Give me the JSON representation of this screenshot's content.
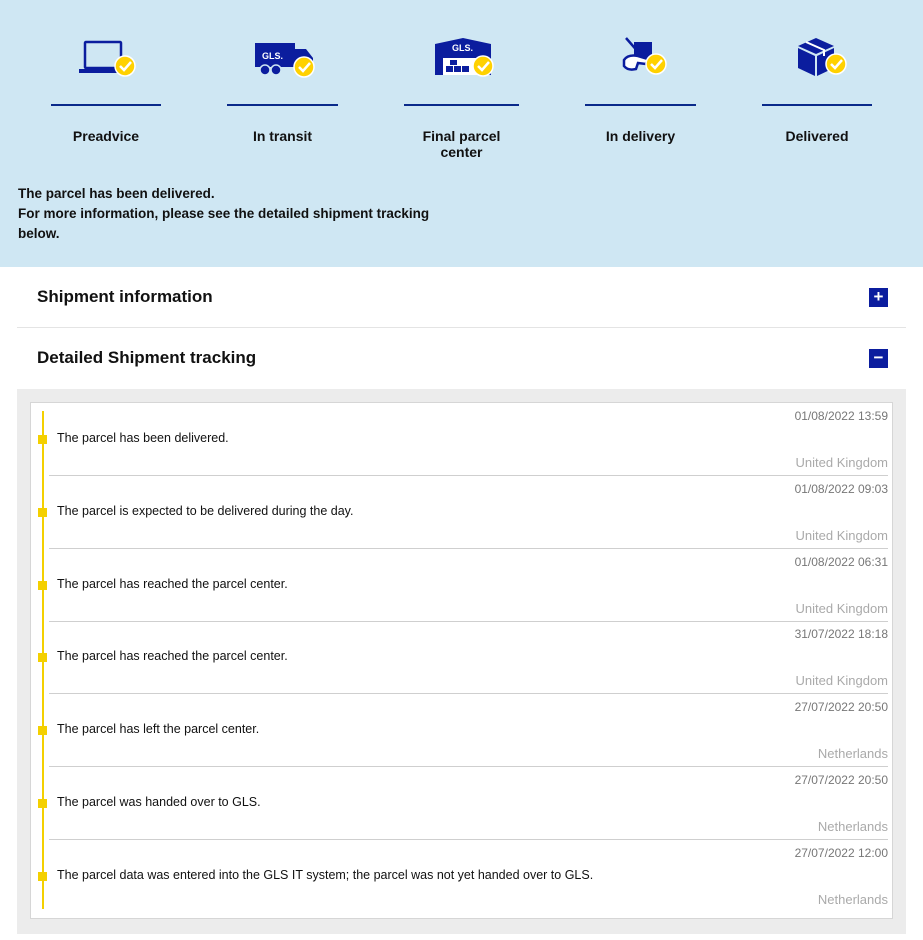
{
  "steps": [
    {
      "label": "Preadvice",
      "icon": "laptop-check-icon"
    },
    {
      "label": "In transit",
      "icon": "truck-check-icon"
    },
    {
      "label": "Final parcel center",
      "icon": "warehouse-check-icon"
    },
    {
      "label": "In delivery",
      "icon": "hand-parcel-check-icon"
    },
    {
      "label": "Delivered",
      "icon": "box-check-icon"
    }
  ],
  "brand_text": "GLS.",
  "status_message": {
    "line1": "The parcel has been delivered.",
    "line2": "For more information, please see the detailed shipment tracking below."
  },
  "accordion": {
    "shipment_info": {
      "title": "Shipment information",
      "toggle": "+"
    },
    "detailed_tracking": {
      "title": "Detailed Shipment tracking",
      "toggle": "−"
    }
  },
  "events": [
    {
      "date": "01/08/2022 13:59",
      "description": "The parcel has been delivered.",
      "country": "United Kingdom"
    },
    {
      "date": "01/08/2022 09:03",
      "description": "The parcel is expected to be delivered during the day.",
      "country": "United Kingdom"
    },
    {
      "date": "01/08/2022 06:31",
      "description": "The parcel has reached the parcel center.",
      "country": "United Kingdom"
    },
    {
      "date": "31/07/2022 18:18",
      "description": "The parcel has reached the parcel center.",
      "country": "United Kingdom"
    },
    {
      "date": "27/07/2022 20:50",
      "description": "The parcel has left the parcel center.",
      "country": "Netherlands"
    },
    {
      "date": "27/07/2022 20:50",
      "description": "The parcel was handed over to GLS.",
      "country": "Netherlands"
    },
    {
      "date": "27/07/2022 12:00",
      "description": "The parcel data was entered into the GLS IT system; the parcel was not yet handed over to GLS.",
      "country": "Netherlands"
    }
  ],
  "colors": {
    "panel_bg": "#cfe7f3",
    "brand_blue": "#0b1d9e",
    "check_yellow": "#ffd100",
    "timeline_yellow": "#f4d000"
  }
}
